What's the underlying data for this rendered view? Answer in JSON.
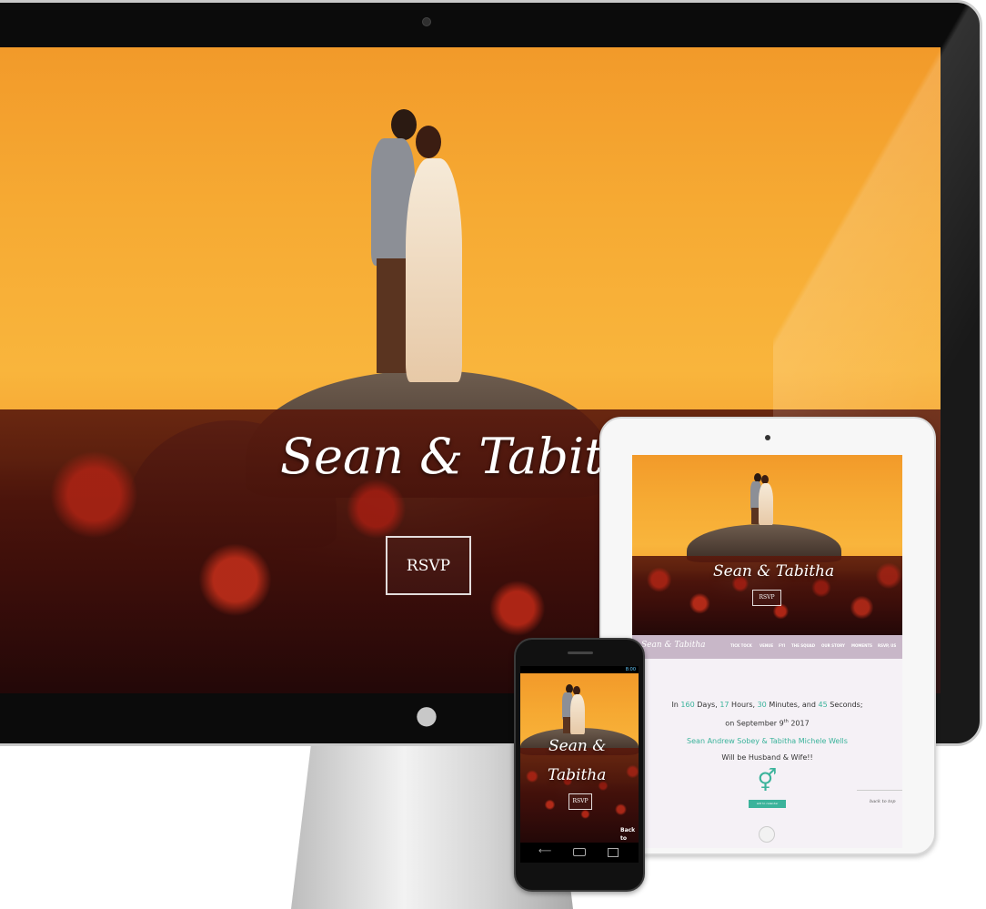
{
  "desktop": {
    "title": "Sean & Tabitha",
    "rsvp": "RSVP"
  },
  "tablet": {
    "title": "Sean & Tabitha",
    "rsvp": "RSVP",
    "nav_brand": "Sean & Tabitha",
    "nav_items": [
      "TICK TOCK",
      "VENUE",
      "FYI",
      "THE SQUAD",
      "OUR STORY",
      "MOMENTS",
      "RSVP, US"
    ],
    "countdown": {
      "prefix": "In",
      "days": "160",
      "days_label": "Days,",
      "hours": "17",
      "hours_label": "Hours,",
      "minutes": "30",
      "minutes_label": "Minutes, and",
      "seconds": "45",
      "seconds_label": "Seconds;",
      "date_prefix": "on September 9",
      "date_sup": "th",
      "date_year": "2017",
      "names": "Sean Andrew Sobey & Tabitha Michele Wells",
      "closing": "Will be Husband & Wife!!",
      "symbol": "⚥",
      "button": "add to calendar",
      "back_to_top": "back to top"
    }
  },
  "phone": {
    "title_line1": "Sean &",
    "title_line2": "Tabitha",
    "rsvp": "RSVP",
    "back_to_top_line1": "Back",
    "back_to_top_line2": "to Top",
    "status_time": "8:00"
  },
  "apple_logo": ""
}
